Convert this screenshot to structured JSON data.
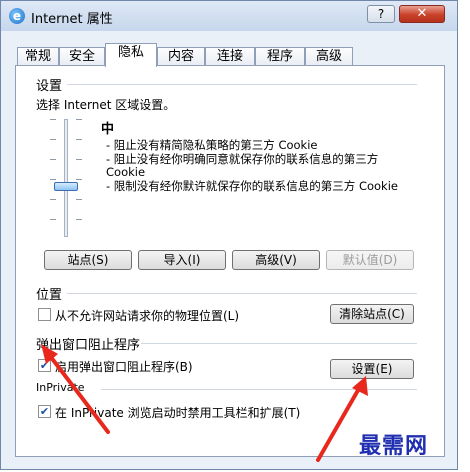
{
  "window": {
    "title": "Internet 属性",
    "help_label": "?",
    "close_label": "✕"
  },
  "tabs": [
    {
      "label": "常规"
    },
    {
      "label": "安全"
    },
    {
      "label": "隐私",
      "active": true
    },
    {
      "label": "内容"
    },
    {
      "label": "连接"
    },
    {
      "label": "程序"
    },
    {
      "label": "高级"
    }
  ],
  "settings": {
    "group_title": "设置",
    "description": "选择 Internet 区域设置。",
    "level_name": "中",
    "slider_level": "中",
    "bullets": [
      "- 阻止没有精简隐私策略的第三方 Cookie",
      "- 阻止没有经你明确同意就保存你的联系信息的第三方 Cookie",
      "- 限制没有经你默许就保存你的联系信息的第三方 Cookie"
    ],
    "buttons": {
      "sites": "站点(S)",
      "import": "导入(I)",
      "advanced": "高级(V)",
      "default": "默认值(D)"
    }
  },
  "location": {
    "group_title": "位置",
    "checkbox_label": "从不允许网站请求你的物理位置(L)",
    "checked": false,
    "clear_button": "清除站点(C)"
  },
  "popup": {
    "group_title": "弹出窗口阻止程序",
    "checkbox_label": "启用弹出窗口阻止程序(B)",
    "checked": true,
    "settings_button": "设置(E)"
  },
  "inprivate": {
    "group_title": "InPrivate",
    "checkbox_label": "在 InPrivate 浏览启动时禁用工具栏和扩展(T)",
    "checked": true
  },
  "watermark": "最需网",
  "colors": {
    "annotation_arrow": "#e8281c",
    "watermark": "#1f2fb0"
  },
  "check_mark": "✔"
}
